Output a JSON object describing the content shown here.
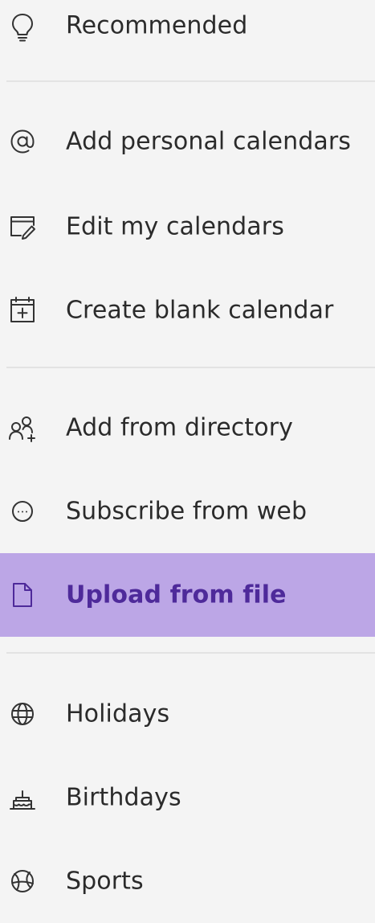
{
  "menu": {
    "recommended": {
      "label": "Recommended",
      "icon": "lightbulb-icon"
    },
    "add_personal": {
      "label": "Add personal calendars",
      "icon": "at-sign-icon"
    },
    "edit_calendars": {
      "label": "Edit my calendars",
      "icon": "edit-calendar-icon"
    },
    "create_blank": {
      "label": "Create blank calendar",
      "icon": "add-calendar-icon"
    },
    "add_directory": {
      "label": "Add from directory",
      "icon": "people-add-icon"
    },
    "subscribe_web": {
      "label": "Subscribe from web",
      "icon": "ellipsis-circle-icon"
    },
    "upload_file": {
      "label": "Upload from file",
      "icon": "document-icon",
      "selected": true
    },
    "holidays": {
      "label": "Holidays",
      "icon": "globe-icon"
    },
    "birthdays": {
      "label": "Birthdays",
      "icon": "cake-icon"
    },
    "sports": {
      "label": "Sports",
      "icon": "sports-ball-icon"
    }
  },
  "colors": {
    "background": "#f4f4f4",
    "selected_background": "#bca6e6",
    "selected_text": "#4e2a9a",
    "text": "#2b2b2b",
    "divider": "#e3e3e3"
  }
}
